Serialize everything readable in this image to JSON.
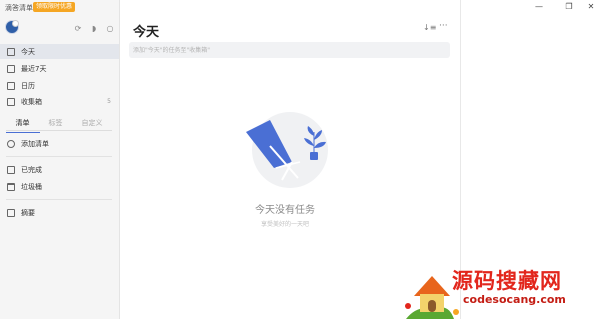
{
  "window": {
    "app_title": "滴答清单",
    "promo_badge": "领取限时优惠",
    "minimize_icon": "minimize-icon",
    "maximize_icon": "maximize-icon",
    "close_icon": "close-icon"
  },
  "sidebar": {
    "top_icons": [
      "sync-icon",
      "bell-icon",
      "search-icon"
    ],
    "smart_lists": [
      {
        "label": "今天",
        "icon": "calendar-today-icon",
        "active": true
      },
      {
        "label": "最近7天",
        "icon": "calendar-week-icon"
      },
      {
        "label": "日历",
        "icon": "calendar-icon"
      },
      {
        "label": "收集箱",
        "icon": "inbox-icon",
        "count": "5"
      }
    ],
    "tabs": [
      {
        "label": "清单",
        "active": true
      },
      {
        "label": "标签"
      },
      {
        "label": "自定义"
      }
    ],
    "add_list_label": "添加清单",
    "completed_label": "已完成",
    "trash_label": "垃圾桶",
    "summary_label": "摘要"
  },
  "main": {
    "title": "今天",
    "add_task_placeholder": "添加\"今天\"的任务至\"收集箱\"",
    "empty_title": "今天没有任务",
    "empty_subtitle": "享受美好的一天吧"
  },
  "watermark": {
    "title": "源码搜藏网",
    "url": "codesocang.com"
  },
  "colors": {
    "accent": "#4a6fd4",
    "promo": "#f5a623",
    "watermark_red": "#e2261c"
  }
}
